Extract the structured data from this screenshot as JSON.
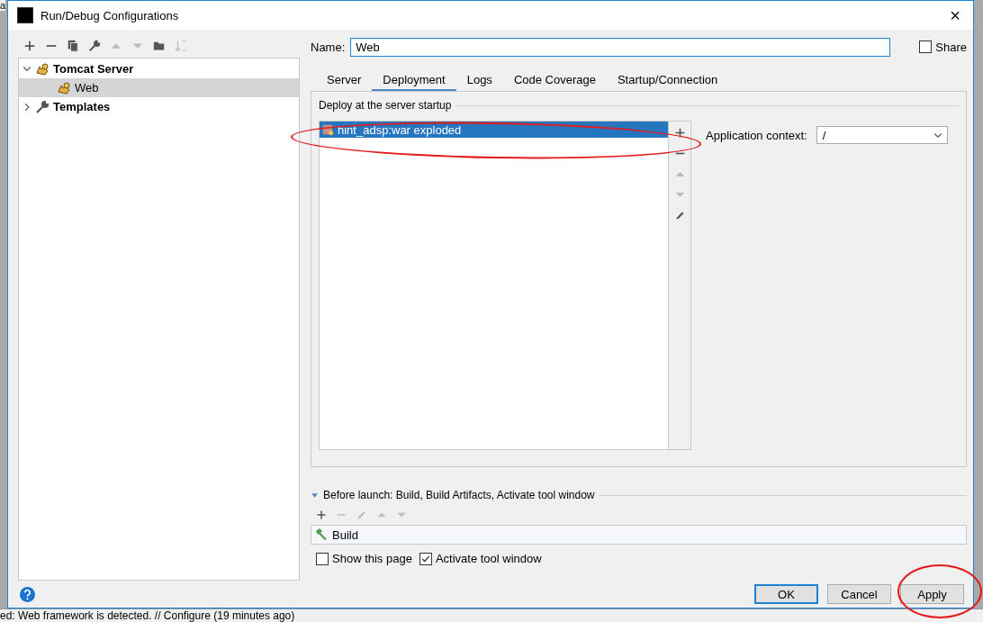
{
  "background": {
    "corner_text": "a",
    "status_text": "ed: Web framework is detected. // Configure (19 minutes ago)"
  },
  "window": {
    "title": "Run/Debug Configurations",
    "close": "×"
  },
  "tree": [
    {
      "label": "Tomcat Server",
      "kind": "tomcat",
      "expanded": true,
      "selected": false,
      "children": [
        {
          "label": "Web",
          "kind": "tomcat",
          "selected": true
        }
      ]
    },
    {
      "label": "Templates",
      "kind": "wrench",
      "expanded": false,
      "selected": false
    }
  ],
  "name": {
    "label": "Name:",
    "value": "Web"
  },
  "share": {
    "label": "Share",
    "checked": false
  },
  "tabs": [
    {
      "label": "Server",
      "selected": false
    },
    {
      "label": "Deployment",
      "selected": true
    },
    {
      "label": "Logs",
      "selected": false
    },
    {
      "label": "Code Coverage",
      "selected": false
    },
    {
      "label": "Startup/Connection",
      "selected": false
    }
  ],
  "deployment": {
    "heading": "Deploy at the server startup",
    "artifacts": [
      {
        "label": "hint_adsp:war exploded",
        "selected": true
      }
    ],
    "context_label": "Application context:",
    "context_value": "/"
  },
  "before_launch": {
    "heading": "Before launch: Build, Build Artifacts, Activate tool window",
    "expanded": true,
    "tasks": [
      {
        "label": "Build"
      }
    ],
    "options": [
      {
        "label": "Show this page",
        "checked": false
      },
      {
        "label": "Activate tool window",
        "checked": true
      }
    ]
  },
  "buttons": [
    {
      "label": "OK",
      "default": true
    },
    {
      "label": "Cancel",
      "default": false
    },
    {
      "label": "Apply",
      "default": false
    }
  ]
}
